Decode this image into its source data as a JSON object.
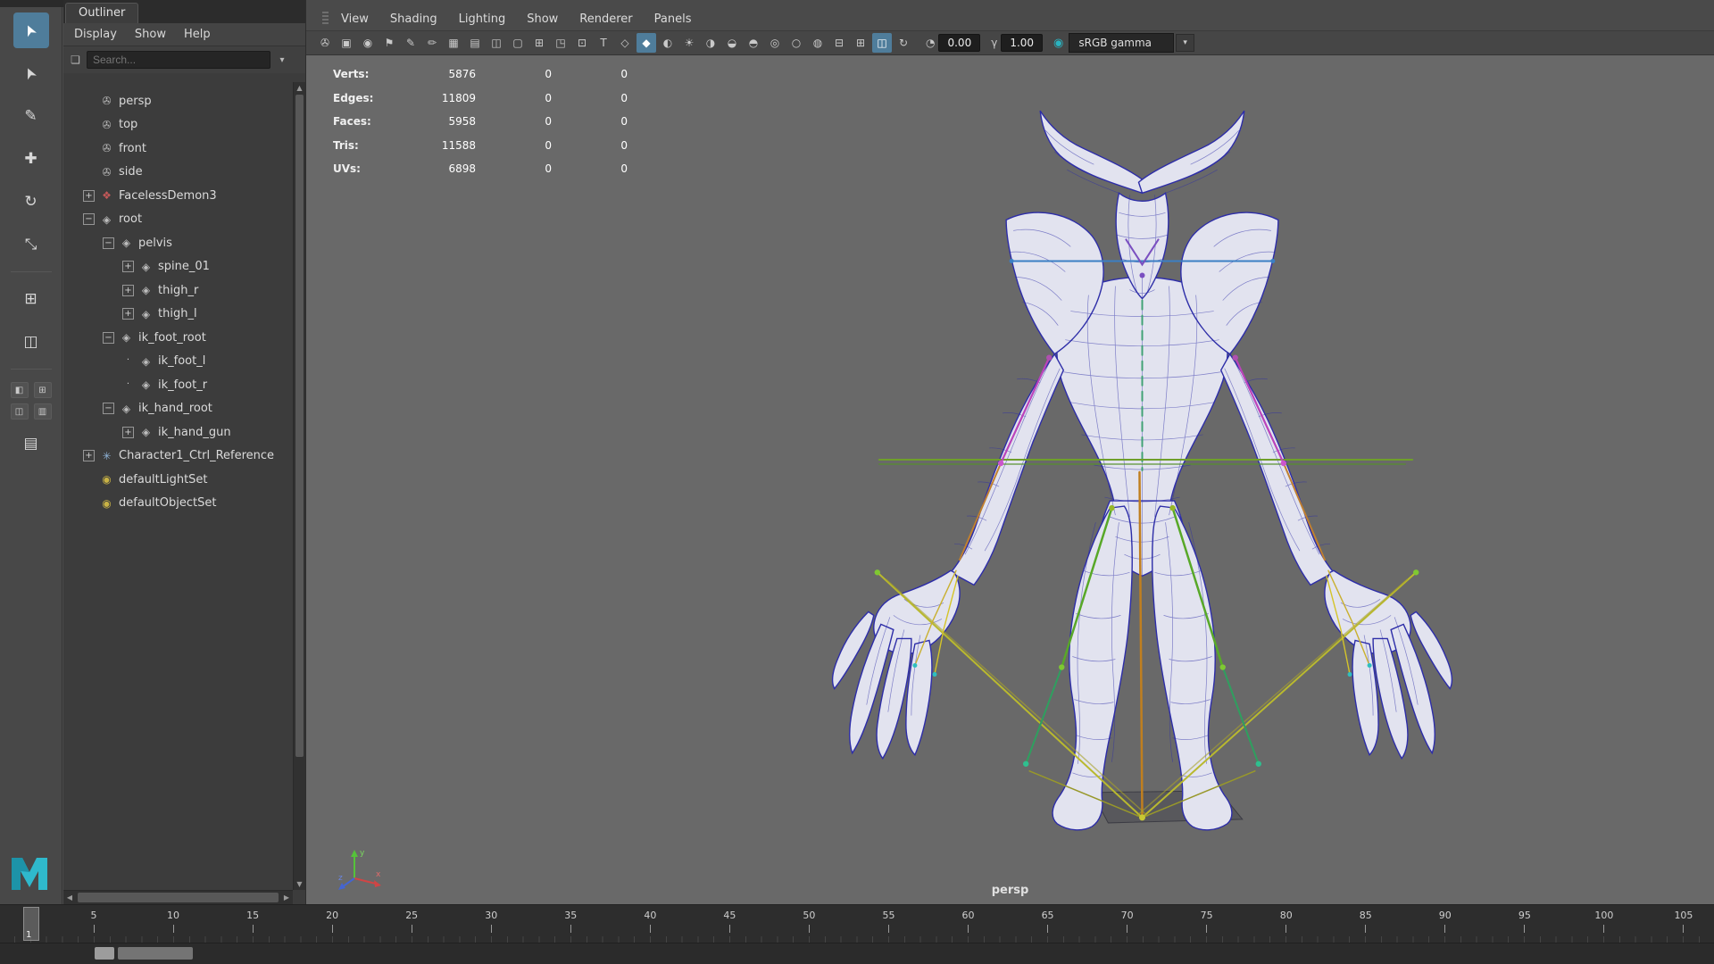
{
  "colors": {
    "accent_blue": "#4f7d9b",
    "viewport_bg": "#696969",
    "wireframe_blue": "#2d2da8",
    "rig_green": "#6f9f2a",
    "rig_yellow": "#b9b92e",
    "rig_orange": "#c07f1f",
    "rig_magenta": "#bb44bb",
    "color_mgmt_teal": "#2ab3c0"
  },
  "toolbox": {
    "tools": [
      {
        "name": "select-tool",
        "glyph": "➤",
        "active": true,
        "rot": true
      },
      {
        "name": "lasso-select-tool",
        "glyph": "➤",
        "active": false,
        "rot": true
      },
      {
        "name": "paint-select-tool",
        "glyph": "✎",
        "active": false,
        "rot": false
      },
      {
        "name": "move-tool",
        "glyph": "✚",
        "active": false,
        "rot": false
      },
      {
        "name": "rotate-tool",
        "glyph": "↻",
        "active": false,
        "rot": false
      },
      {
        "name": "scale-tool",
        "glyph": "⤡",
        "active": false,
        "rot": false
      }
    ],
    "extra_tools": [
      {
        "name": "last-tool",
        "glyph": "⊞",
        "active": false,
        "rot": false
      },
      {
        "name": "component-tool",
        "glyph": "◫",
        "active": false,
        "rot": false
      }
    ],
    "layout_buttons": [
      {
        "name": "layout-single-pane",
        "glyph": "◧"
      },
      {
        "name": "layout-four-pane",
        "glyph": "⊞"
      },
      {
        "name": "layout-persp-outliner",
        "glyph": "◫"
      },
      {
        "name": "layout-persp-graph",
        "glyph": "▥"
      }
    ],
    "panel_list_glyph": "▤"
  },
  "outliner": {
    "tab": "Outliner",
    "menus": [
      "Display",
      "Show",
      "Help"
    ],
    "search_placeholder": "Search...",
    "filter_icon_glyph": "❏",
    "dropdown_glyph": "▾",
    "tree": [
      {
        "label": "persp",
        "icon": "camera-icon",
        "glyph": "✇",
        "color": "#b9b9b9",
        "indent": 22,
        "exp": "",
        "boxed": false
      },
      {
        "label": "top",
        "icon": "camera-icon",
        "glyph": "✇",
        "color": "#b9b9b9",
        "indent": 22,
        "exp": "",
        "boxed": false
      },
      {
        "label": "front",
        "icon": "camera-icon",
        "glyph": "✇",
        "color": "#b9b9b9",
        "indent": 22,
        "exp": "",
        "boxed": false
      },
      {
        "label": "side",
        "icon": "camera-icon",
        "glyph": "✇",
        "color": "#b9b9b9",
        "indent": 22,
        "exp": "",
        "boxed": false
      },
      {
        "label": "FacelessDemon3",
        "icon": "mesh-icon",
        "glyph": "❖",
        "color": "#c25858",
        "indent": 22,
        "exp": "+",
        "boxed": true
      },
      {
        "label": "root",
        "icon": "joint-icon",
        "glyph": "◈",
        "color": "#bdbdbd",
        "indent": 22,
        "exp": "−",
        "boxed": true
      },
      {
        "label": "pelvis",
        "icon": "joint-icon",
        "glyph": "◈",
        "color": "#bdbdbd",
        "indent": 44,
        "exp": "−",
        "boxed": true
      },
      {
        "label": "spine_01",
        "icon": "joint-icon",
        "glyph": "◈",
        "color": "#bdbdbd",
        "indent": 66,
        "exp": "+",
        "boxed": true
      },
      {
        "label": "thigh_r",
        "icon": "joint-icon",
        "glyph": "◈",
        "color": "#bdbdbd",
        "indent": 66,
        "exp": "+",
        "boxed": true
      },
      {
        "label": "thigh_l",
        "icon": "joint-icon",
        "glyph": "◈",
        "color": "#bdbdbd",
        "indent": 66,
        "exp": "+",
        "boxed": true
      },
      {
        "label": "ik_foot_root",
        "icon": "joint-icon",
        "glyph": "◈",
        "color": "#bdbdbd",
        "indent": 44,
        "exp": "−",
        "boxed": true
      },
      {
        "label": "ik_foot_l",
        "icon": "ik-handle-icon",
        "glyph": "◈",
        "color": "#bdbdbd",
        "indent": 66,
        "exp": "·",
        "boxed": false
      },
      {
        "label": "ik_foot_r",
        "icon": "ik-handle-icon",
        "glyph": "◈",
        "color": "#bdbdbd",
        "indent": 66,
        "exp": "·",
        "boxed": false
      },
      {
        "label": "ik_hand_root",
        "icon": "joint-icon",
        "glyph": "◈",
        "color": "#bdbdbd",
        "indent": 44,
        "exp": "−",
        "boxed": true
      },
      {
        "label": "ik_hand_gun",
        "icon": "joint-icon",
        "glyph": "◈",
        "color": "#bdbdbd",
        "indent": 66,
        "exp": "+",
        "boxed": true
      },
      {
        "label": "Character1_Ctrl_Reference",
        "icon": "character-ctrl-icon",
        "glyph": "✳",
        "color": "#8fb4d8",
        "indent": 22,
        "exp": "+",
        "boxed": true
      },
      {
        "label": "defaultLightSet",
        "icon": "light-set-icon",
        "glyph": "◉",
        "color": "#c8b245",
        "indent": 22,
        "exp": "",
        "boxed": false
      },
      {
        "label": "defaultObjectSet",
        "icon": "object-set-icon",
        "glyph": "◉",
        "color": "#c8b245",
        "indent": 22,
        "exp": "",
        "boxed": false
      }
    ]
  },
  "viewport": {
    "menus": [
      "View",
      "Shading",
      "Lighting",
      "Show",
      "Renderer",
      "Panels"
    ],
    "toolbar_icons": [
      {
        "name": "camera-select-icon",
        "glyph": "✇",
        "active": false,
        "gap": false
      },
      {
        "name": "camera-lock-icon",
        "glyph": "▣",
        "active": false,
        "gap": false
      },
      {
        "name": "camera-attributes-icon",
        "glyph": "◉",
        "active": false,
        "gap": false
      },
      {
        "name": "bookmark-icon",
        "glyph": "⚑",
        "active": false,
        "gap": false
      },
      {
        "name": "grease-pencil-icon",
        "glyph": "✎",
        "active": false,
        "gap": true
      },
      {
        "name": "grease-frame-icon",
        "glyph": "✏",
        "active": false,
        "gap": false
      },
      {
        "name": "grid-icon",
        "glyph": "▦",
        "active": false,
        "gap": true
      },
      {
        "name": "film-gate-icon",
        "glyph": "▤",
        "active": false,
        "gap": false
      },
      {
        "name": "resolution-gate-icon",
        "glyph": "◫",
        "active": false,
        "gap": false
      },
      {
        "name": "gate-mask-icon",
        "glyph": "▢",
        "active": false,
        "gap": false
      },
      {
        "name": "field-chart-icon",
        "glyph": "⊞",
        "active": false,
        "gap": false
      },
      {
        "name": "safe-action-icon",
        "glyph": "◳",
        "active": false,
        "gap": false
      },
      {
        "name": "safe-title-icon",
        "glyph": "⊡",
        "active": false,
        "gap": false
      },
      {
        "name": "title-text-icon",
        "glyph": "T",
        "active": false,
        "gap": false
      },
      {
        "name": "wireframe-mode-icon",
        "glyph": "◇",
        "active": false,
        "gap": true
      },
      {
        "name": "shaded-mode-icon",
        "glyph": "◆",
        "active": true,
        "gap": false
      },
      {
        "name": "textured-mode-icon",
        "glyph": "◐",
        "active": false,
        "gap": false
      },
      {
        "name": "use-all-lights-icon",
        "glyph": "☀",
        "active": false,
        "gap": false
      },
      {
        "name": "shadows-icon",
        "glyph": "◑",
        "active": false,
        "gap": false
      },
      {
        "name": "ambient-occlusion-icon",
        "glyph": "◒",
        "active": false,
        "gap": false
      },
      {
        "name": "motion-blur-icon",
        "glyph": "◓",
        "active": false,
        "gap": false
      },
      {
        "name": "xray-icon",
        "glyph": "◎",
        "active": false,
        "gap": true
      },
      {
        "name": "xray-joints-icon",
        "glyph": "○",
        "active": false,
        "gap": false
      },
      {
        "name": "isolate-select-icon",
        "glyph": "◍",
        "active": false,
        "gap": true
      },
      {
        "name": "pane-single-icon",
        "glyph": "⊟",
        "active": false,
        "gap": true
      },
      {
        "name": "pane-four-icon",
        "glyph": "⊞",
        "active": false,
        "gap": false
      },
      {
        "name": "pane-outliner-icon",
        "glyph": "◫",
        "active": true,
        "gap": false
      },
      {
        "name": "refresh-view-icon",
        "glyph": "↻",
        "active": false,
        "gap": true
      }
    ],
    "exposure": {
      "icon_glyph": "◔",
      "value": "0.00"
    },
    "gamma": {
      "icon_glyph": "γ",
      "value": "1.00"
    },
    "color_mgmt_glyph": "◉",
    "view_transform": "sRGB gamma",
    "view_transform_arrow": "▾",
    "hud_rows": [
      {
        "label": "Verts:",
        "total": "5876",
        "col2": "0",
        "col3": "0"
      },
      {
        "label": "Edges:",
        "total": "11809",
        "col2": "0",
        "col3": "0"
      },
      {
        "label": "Faces:",
        "total": "5958",
        "col2": "0",
        "col3": "0"
      },
      {
        "label": "Tris:",
        "total": "11588",
        "col2": "0",
        "col3": "0"
      },
      {
        "label": "UVs:",
        "total": "6898",
        "col2": "0",
        "col3": "0"
      }
    ],
    "camera_label": "persp",
    "axis": {
      "x": "x",
      "y": "y",
      "z": "z"
    }
  },
  "timeline": {
    "ticks": [
      "5",
      "10",
      "15",
      "20",
      "25",
      "30",
      "35",
      "40",
      "45",
      "50",
      "55",
      "60",
      "65",
      "70",
      "75",
      "80",
      "85",
      "90",
      "95",
      "100",
      "105"
    ],
    "current_frame": "1"
  },
  "scrollbar": {
    "up": "▲",
    "down": "▼",
    "left": "◀",
    "right": "▶"
  }
}
